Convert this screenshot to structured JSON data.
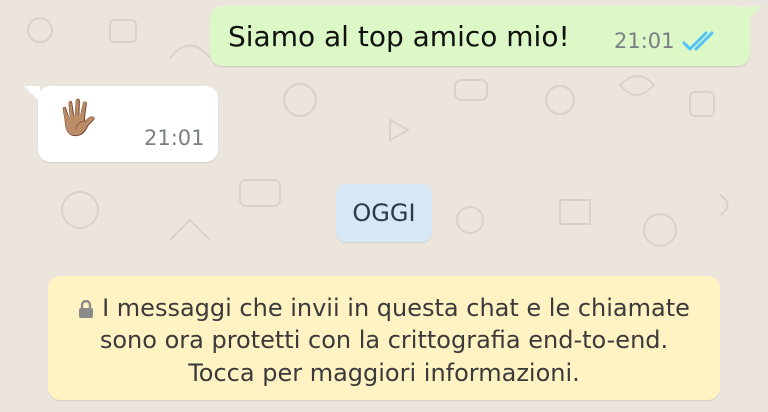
{
  "chat": {
    "messages": [
      {
        "direction": "outgoing",
        "text": "Siamo al top amico mio!",
        "time": "21:01",
        "status_icon": "double-check-read-icon"
      },
      {
        "direction": "incoming",
        "text": "🖐🏽",
        "time": "21:01"
      }
    ],
    "date_separator": "OGGI",
    "encryption_notice": {
      "line1": "I messaggi che invii in questa chat e le chiamate",
      "line2": "sono ora protetti con la crittografia end-to-end.",
      "line3": "Tocca per maggiori informazioni.",
      "icon": "lock-icon"
    }
  },
  "colors": {
    "background": "#ece5dd",
    "outgoing_bubble": "#dcf8c6",
    "incoming_bubble": "#ffffff",
    "date_pill": "#d6e8f5",
    "encryption_notice": "#fff3c4",
    "read_ticks": "#4fc3f7"
  }
}
